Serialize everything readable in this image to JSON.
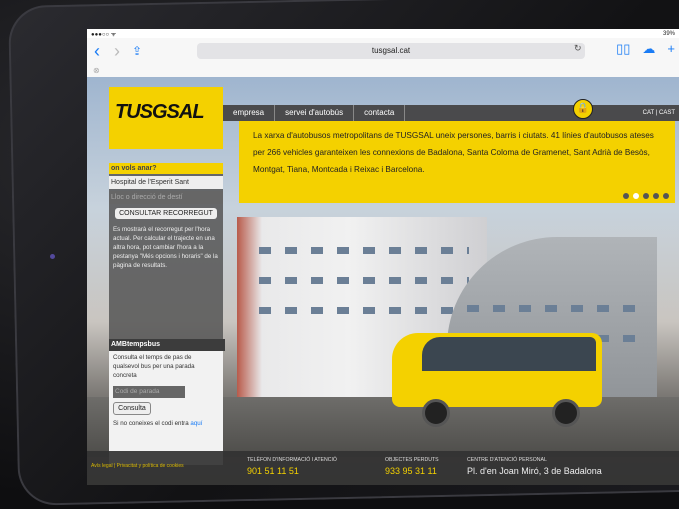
{
  "status": {
    "battery": "39%"
  },
  "browser": {
    "url": "tusgsal.cat"
  },
  "site": {
    "logo": "TUSGSAL",
    "menu": [
      "empresa",
      "servei d'autobús",
      "contacta"
    ],
    "lang": "CAT | CAST",
    "info": "La xarxa d'autobusos metropolitans de TUSGSAL uneix persones, barris i ciutats. 41 línies d'autobusos ateses per 266 vehicles garanteixen les connexions de Badalona, Santa Coloma de Gramenet, Sant Adrià de Besòs, Montgat, Tiana, Montcada i Reixac i Barcelona."
  },
  "sidebar": {
    "heading": "on vols anar?",
    "origin_value": "Hospital de l'Esperit Sant",
    "dest_placeholder": "Lloc o direcció de destí",
    "consult_route": "CONSULTAR RECORREGUT",
    "help": "Es mostrarà el recorregut per l'hora actual. Per calcular el trajecte en una altra hora, pot cambiar l'hora a la pestanya \"Més opcions i horaris\" de la pàgina de resultats."
  },
  "amb": {
    "title": "AMBtempsbus",
    "text": "Consulta el temps de pas de qualsevol bus per una parada concreta",
    "code_placeholder": "Codi de parada",
    "button": "Consulta",
    "hint": "Si no coneixes el codi entra"
  },
  "footer": {
    "links": "Avís legal | Privacitat y política de cookies",
    "phone_label": "TELÈFON D'INFORMACIÓ I ATENCIÓ",
    "phone": "901 51 11 51",
    "lost_label": "OBJECTES PERDUTS",
    "lost": "933 95 31 11",
    "center_label": "CENTRE D'ATENCIÓ PERSONAL",
    "center": "Pl. d'en Joan Miró, 3 de Badalona"
  }
}
